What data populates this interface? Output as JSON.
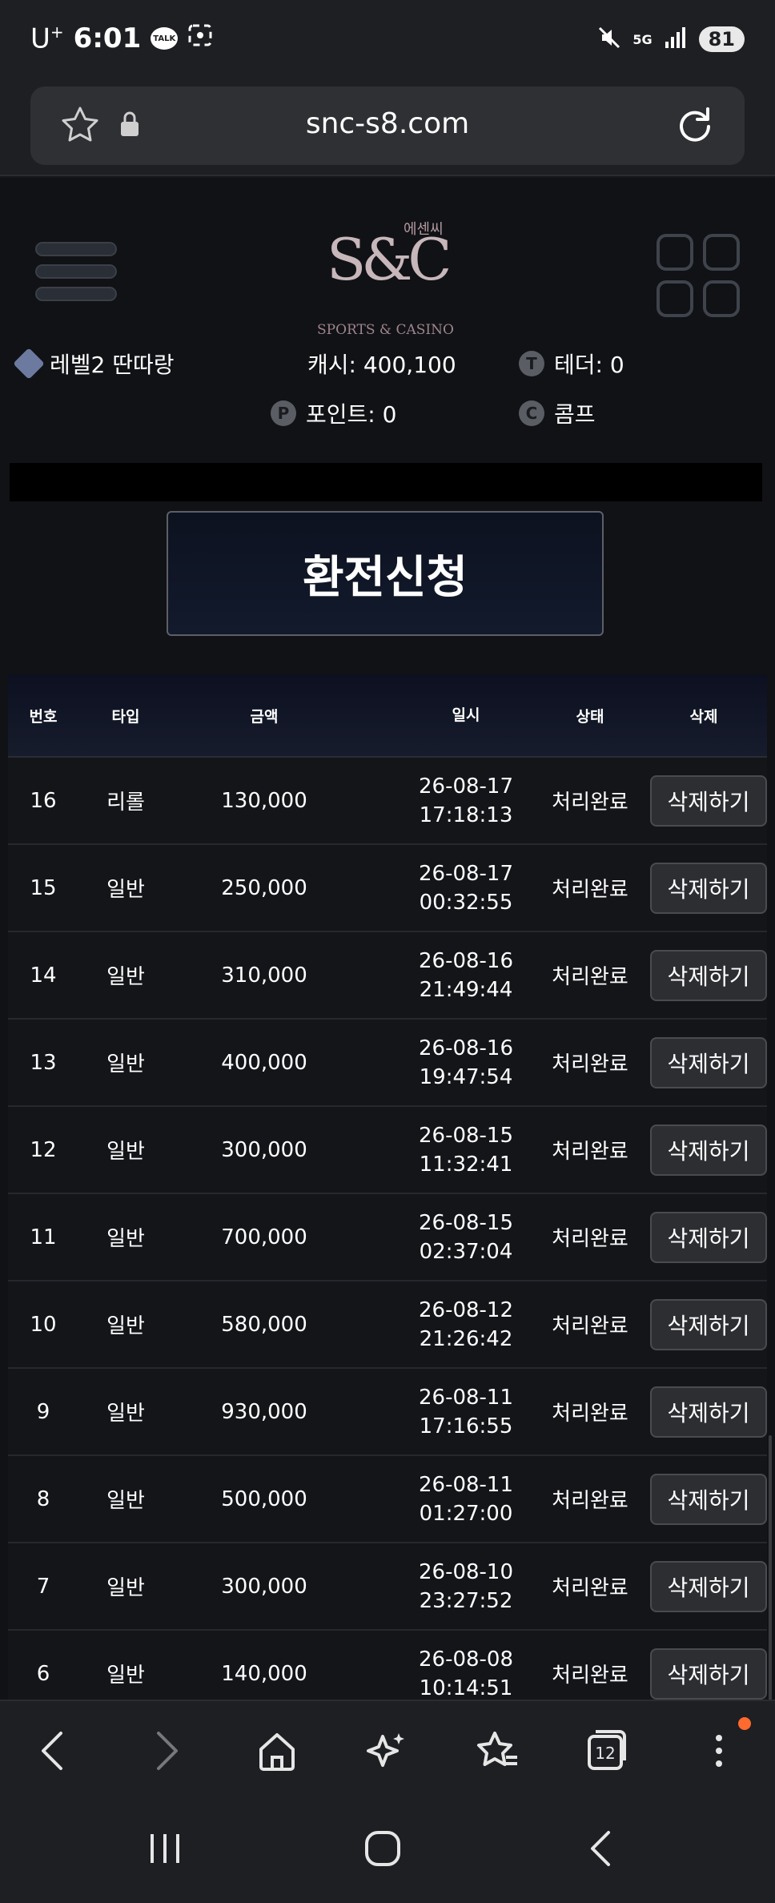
{
  "status_bar": {
    "carrier": "U",
    "carrier_sup": "+",
    "time": "6:01",
    "talk_label": "TALK",
    "battery": "81",
    "network": "5G"
  },
  "browser": {
    "url": "snc-s8.com"
  },
  "site": {
    "logo_korean": "에센씨",
    "logo_mono": "S&C",
    "logo_sub": "SPORTS & CASINO",
    "user_level": "레벨2 딴따랑",
    "cash": "캐시: 400,100",
    "tether": "테더: 0",
    "points": "포인트: 0",
    "comp": "콤프",
    "page_title": "환전신청"
  },
  "table": {
    "headers": [
      "번호",
      "타입",
      "금액",
      "일시",
      "상태",
      "삭제"
    ],
    "delete_label": "삭제하기",
    "rows": [
      {
        "no": "16",
        "type": "리롤",
        "amount": "130,000",
        "date": "26-08-17",
        "time": "17:18:13",
        "status": "처리완료"
      },
      {
        "no": "15",
        "type": "일반",
        "amount": "250,000",
        "date": "26-08-17",
        "time": "00:32:55",
        "status": "처리완료"
      },
      {
        "no": "14",
        "type": "일반",
        "amount": "310,000",
        "date": "26-08-16",
        "time": "21:49:44",
        "status": "처리완료"
      },
      {
        "no": "13",
        "type": "일반",
        "amount": "400,000",
        "date": "26-08-16",
        "time": "19:47:54",
        "status": "처리완료"
      },
      {
        "no": "12",
        "type": "일반",
        "amount": "300,000",
        "date": "26-08-15",
        "time": "11:32:41",
        "status": "처리완료"
      },
      {
        "no": "11",
        "type": "일반",
        "amount": "700,000",
        "date": "26-08-15",
        "time": "02:37:04",
        "status": "처리완료"
      },
      {
        "no": "10",
        "type": "일반",
        "amount": "580,000",
        "date": "26-08-12",
        "time": "21:26:42",
        "status": "처리완료"
      },
      {
        "no": "9",
        "type": "일반",
        "amount": "930,000",
        "date": "26-08-11",
        "time": "17:16:55",
        "status": "처리완료"
      },
      {
        "no": "8",
        "type": "일반",
        "amount": "500,000",
        "date": "26-08-11",
        "time": "01:27:00",
        "status": "처리완료"
      },
      {
        "no": "7",
        "type": "일반",
        "amount": "300,000",
        "date": "26-08-10",
        "time": "23:27:52",
        "status": "처리완료"
      },
      {
        "no": "6",
        "type": "일반",
        "amount": "140,000",
        "date": "26-08-08",
        "time": "10:14:51",
        "status": "처리완료"
      }
    ]
  },
  "bottom_nav": {
    "tabs_count": "12"
  },
  "icons": {
    "back": "back-icon",
    "forward": "forward-icon",
    "home": "home-icon",
    "ai": "sparkle-icon",
    "bookmarks": "bookmark-star-icon",
    "tabs": "tabs-icon",
    "menu": "more-vertical-icon"
  },
  "colors": {
    "background": "#111215",
    "browser_chrome": "#1e1f23",
    "button": "#2d2e32",
    "notification": "#ff6a2e"
  }
}
